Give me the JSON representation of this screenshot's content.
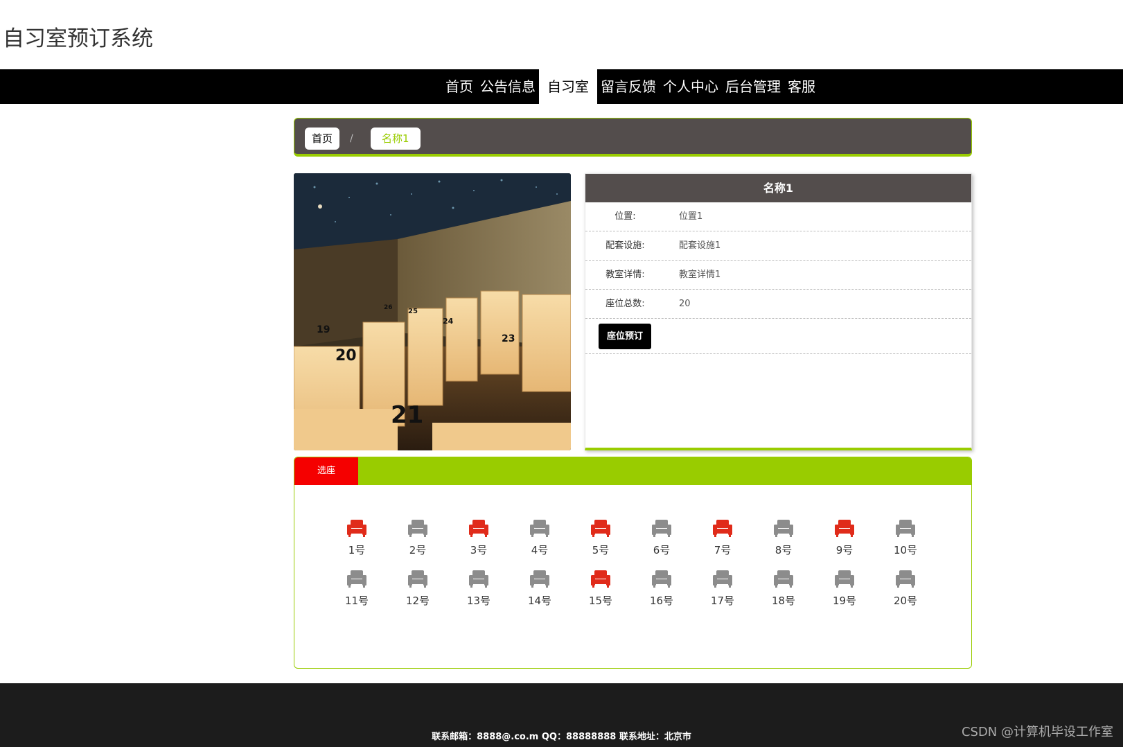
{
  "site": {
    "title": "自习室预订系统"
  },
  "nav": [
    {
      "label": "首页",
      "active": false
    },
    {
      "label": "公告信息",
      "active": false
    },
    {
      "label": "自习室",
      "active": true
    },
    {
      "label": "留言反馈",
      "active": false
    },
    {
      "label": "个人中心",
      "active": false
    },
    {
      "label": "后台管理",
      "active": false
    },
    {
      "label": "客服",
      "active": false
    }
  ],
  "breadcrumb": {
    "home": "首页",
    "separator": "/",
    "current": "名称1"
  },
  "room": {
    "name": "名称1",
    "fields": [
      {
        "label": "位置:",
        "value": "位置1"
      },
      {
        "label": "配套设施:",
        "value": "配套设施1"
      },
      {
        "label": "教室详情:",
        "value": "教室详情1"
      },
      {
        "label": "座位总数:",
        "value": "20"
      }
    ],
    "book_button": "座位预订"
  },
  "seats": {
    "tab_label": "选座",
    "occupied_color": "#e02b1a",
    "free_color": "#8c8c8c",
    "items": [
      {
        "label": "1号",
        "status": "occupied"
      },
      {
        "label": "2号",
        "status": "free"
      },
      {
        "label": "3号",
        "status": "occupied"
      },
      {
        "label": "4号",
        "status": "free"
      },
      {
        "label": "5号",
        "status": "occupied"
      },
      {
        "label": "6号",
        "status": "free"
      },
      {
        "label": "7号",
        "status": "occupied"
      },
      {
        "label": "8号",
        "status": "free"
      },
      {
        "label": "9号",
        "status": "occupied"
      },
      {
        "label": "10号",
        "status": "free"
      },
      {
        "label": "11号",
        "status": "free"
      },
      {
        "label": "12号",
        "status": "free"
      },
      {
        "label": "13号",
        "status": "free"
      },
      {
        "label": "14号",
        "status": "free"
      },
      {
        "label": "15号",
        "status": "occupied"
      },
      {
        "label": "16号",
        "status": "free"
      },
      {
        "label": "17号",
        "status": "free"
      },
      {
        "label": "18号",
        "status": "free"
      },
      {
        "label": "19号",
        "status": "free"
      },
      {
        "label": "20号",
        "status": "free"
      }
    ]
  },
  "footer": {
    "contact": "联系邮箱：8888@.co.m QQ：88888888 联系地址：北京市",
    "watermark": "CSDN @计算机毕设工作室"
  },
  "colors": {
    "accent": "#99cc00",
    "header_bar": "#000000",
    "panel_dark": "#534d4c",
    "tab_red": "#f50000"
  }
}
